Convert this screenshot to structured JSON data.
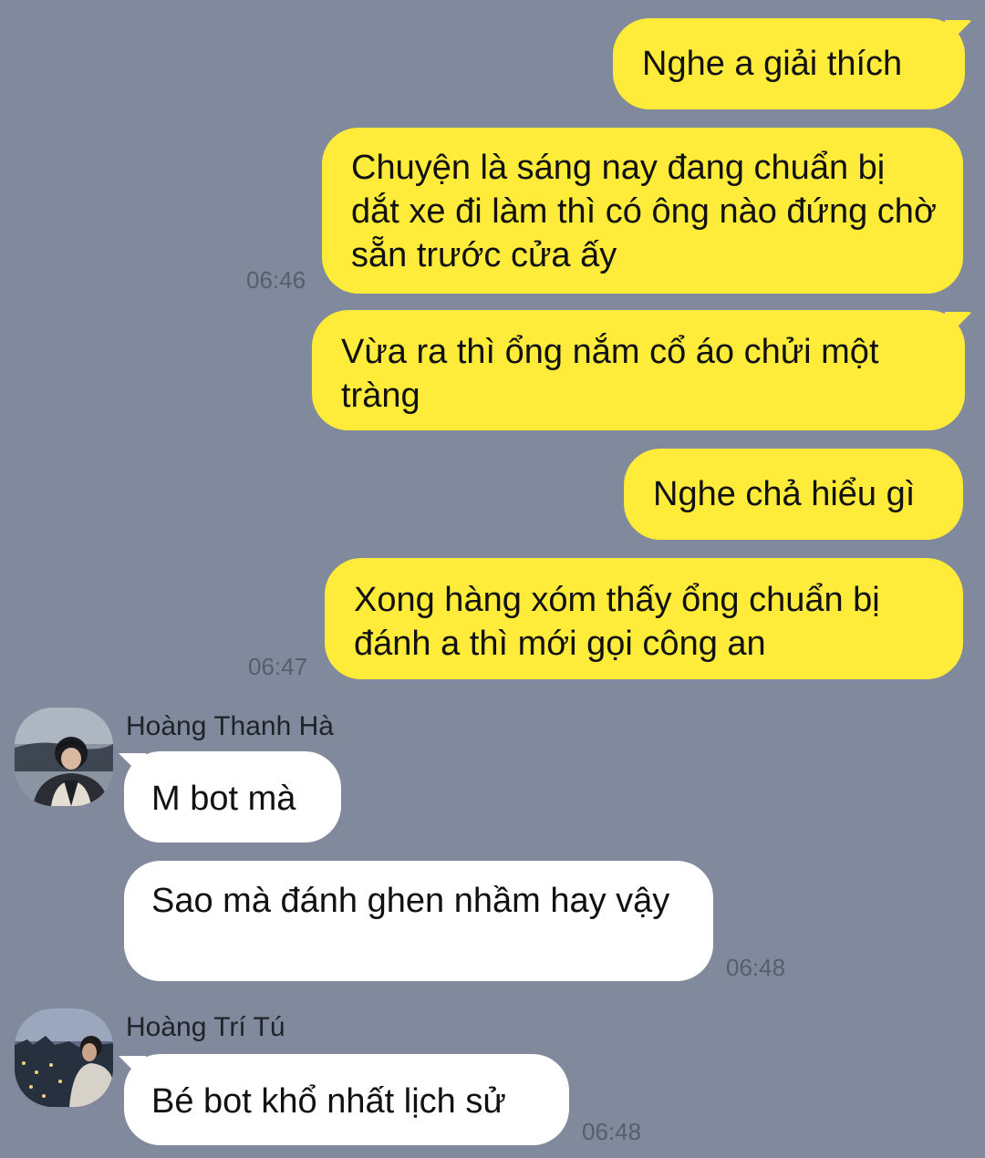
{
  "messages": {
    "m1": {
      "text": "Nghe a giải thích"
    },
    "m2": {
      "text": "Chuyện là sáng nay đang chuẩn bị dắt xe đi làm thì có ông nào đứng chờ sẵn trước cửa ấy",
      "time": "06:46"
    },
    "m3": {
      "text": "Vừa ra thì ổng nắm cổ áo chửi một tràng"
    },
    "m4": {
      "text": "Nghe chả hiểu gì"
    },
    "m5": {
      "text": "Xong hàng xóm thấy ổng chuẩn bị đánh a thì mới gọi công an",
      "time": "06:47"
    },
    "m6": {
      "sender": "Hoàng Thanh Hà",
      "text": "M bot mà"
    },
    "m7": {
      "text": "Sao mà đánh ghen nhầm hay vậy",
      "time": "06:48"
    },
    "m8": {
      "sender": "Hoàng Trí Tú",
      "text": "Bé bot khổ nhất lịch sử",
      "time": "06:48"
    }
  },
  "icons": {
    "avatar1": "avatar-photo-icon",
    "avatar2": "avatar-photo-icon"
  },
  "colors": {
    "background": "#818a9c",
    "outgoing_bubble": "#feeb3a",
    "incoming_bubble": "#ffffff",
    "timestamp": "#565e6d"
  }
}
